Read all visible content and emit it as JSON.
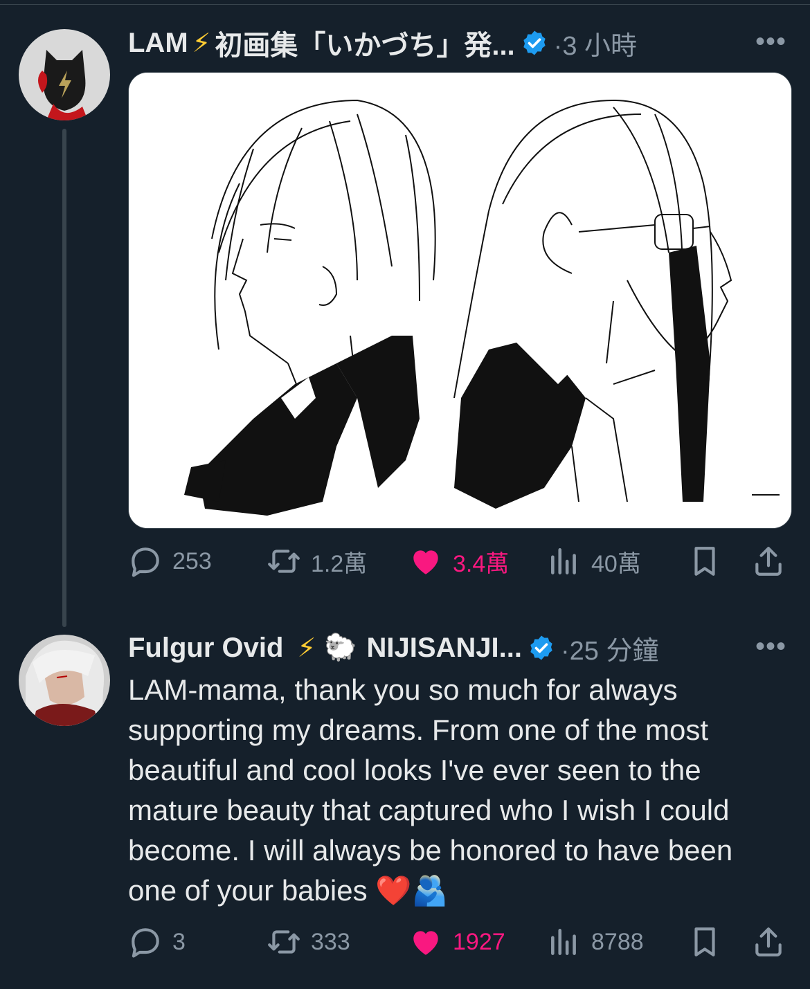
{
  "tweet1": {
    "display_name": "LAM",
    "name_emoji": "⚡",
    "name_suffix": "初画集「いかづち」発...",
    "time": "·3 小時",
    "more": "•••",
    "stats": {
      "replies": "253",
      "retweets": "1.2萬",
      "likes": "3.4萬",
      "views": "40萬"
    }
  },
  "tweet2": {
    "display_name": "Fulgur Ovid",
    "name_emoji_1": "⚡",
    "name_emoji_2": "🐑",
    "name_suffix": "NIJISANJI...",
    "time": "·25 分鐘",
    "more": "•••",
    "text": "LAM-mama, thank you so much for always supporting my dreams. From one of the most beautiful and cool looks I've ever seen to the mature beauty that captured who I wish I could become. I will always be honored to have been one of your babies ❤️🫂",
    "stats": {
      "replies": "3",
      "retweets": "333",
      "likes": "1927",
      "views": "8788"
    }
  },
  "colors": {
    "background": "#15202b",
    "secondary_text": "#8b98a5",
    "like_pink": "#f91880",
    "verified_blue": "#1d9bf0"
  },
  "icons": [
    "reply-icon",
    "retweet-icon",
    "like-icon",
    "views-icon",
    "bookmark-icon",
    "share-icon",
    "verified-badge-icon",
    "more-icon"
  ]
}
